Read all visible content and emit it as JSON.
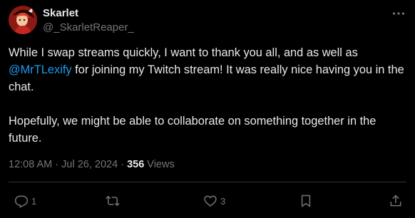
{
  "tweet": {
    "author": {
      "display_name": "Skarlet",
      "handle": "@_SkarletReaper_"
    },
    "text": {
      "p1_before": "While I swap streams quickly, I want to thank you all, and as well as ",
      "mention": "@MrTLexify",
      "p1_after": " for joining my Twitch stream! It was really nice having you in the chat.",
      "p2": "Hopefully, we might be able to collaborate on something together in the future."
    },
    "meta": {
      "time": "12:08 AM",
      "separator": " · ",
      "date": "Jul 26, 2024",
      "views_count": "356",
      "views_label": " Views"
    },
    "actions": {
      "reply_count": "1",
      "retweet_count": "",
      "like_count": "3"
    }
  },
  "icons": {
    "avatar": "avatar-image",
    "more": "more-icon",
    "reply": "reply-icon",
    "retweet": "retweet-icon",
    "like": "heart-icon",
    "bookmark": "bookmark-icon",
    "share": "share-icon"
  },
  "colors": {
    "background": "#000000",
    "text": "#e7e9ea",
    "secondary": "#71767b",
    "link": "#1d9bf0",
    "divider": "#2f3336"
  }
}
